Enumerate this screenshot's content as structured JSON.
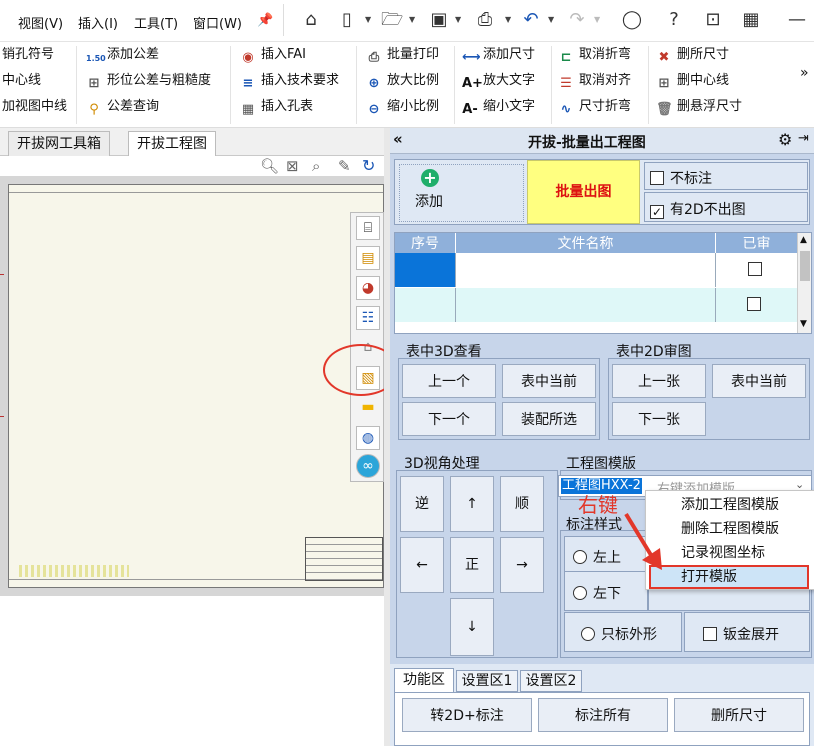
{
  "menubar": {
    "items": [
      "视图(V)",
      "插入(I)",
      "工具(T)",
      "窗口(W)"
    ],
    "pin": "📌",
    "quick_icons": [
      "home-icon",
      "new-file-icon",
      "open-folder-icon",
      "save-icon",
      "print-icon",
      "undo-icon",
      "redo-icon",
      "user-icon",
      "help-icon",
      "minimize-icon"
    ]
  },
  "ribbon": {
    "col1": [
      "销孔符号",
      "中心线",
      "加视图中线"
    ],
    "col2": [
      "添加公差",
      "形位公差与粗糙度",
      "公差查询"
    ],
    "col3": [
      "插入FAI",
      "插入技术要求",
      "插入孔表"
    ],
    "col4": [
      "批量打印",
      "放大比例",
      "缩小比例"
    ],
    "col5": [
      "添加尺寸",
      "放大文字",
      "缩小文字"
    ],
    "col6": [
      "取消折弯",
      "取消对齐",
      "尺寸折弯"
    ],
    "col7": [
      "删所尺寸",
      "删中心线",
      "删悬浮尺寸"
    ],
    "icon_labels": {
      "tol": "1.50",
      "bigA": "A+",
      "smallA": "A-"
    },
    "more": "»"
  },
  "left_tabs": [
    "开拔网工具箱",
    "开拔工程图"
  ],
  "panel": {
    "title": "开拔-批量出工程图",
    "collapse": "«",
    "add_label": "添加",
    "batch_label": "批量出图",
    "no_annotate": "不标注",
    "skip_2d": "有2D不出图",
    "skip_2d_checked": true,
    "table_headers": [
      "序号",
      "文件名称",
      "已审"
    ],
    "group_3d": "表中3D查看",
    "btn_prev": "上一个",
    "btn_current3d": "表中当前",
    "btn_next": "下一个",
    "btn_assembly": "装配所选",
    "group_2d": "表中2D审图",
    "btn_prev_sheet": "上一张",
    "btn_current2d": "表中当前",
    "btn_next_sheet": "下一张",
    "group_view": "3D视角处理",
    "view_btns": [
      "逆",
      "↑",
      "顺",
      "←",
      "正",
      "→",
      "↓"
    ],
    "group_template": "工程图模版",
    "template_value": "工程图HXX-2",
    "template_hint": "右键添加模版",
    "group_style": "标注样式",
    "style_opts": [
      "左上",
      "左下"
    ],
    "only_outline": "只标外形",
    "sheetmetal": "钣金展开",
    "bottom_tabs": [
      "功能区",
      "设置区1",
      "设置区2"
    ],
    "bottom_btns": [
      "转2D+标注",
      "标注所有",
      "删所尺寸"
    ]
  },
  "context_menu": {
    "items": [
      "添加工程图模版",
      "删除工程图模版",
      "记录视图坐标",
      "打开模版"
    ]
  },
  "annotation": {
    "right_click": "右键",
    "color": "#e2372a"
  }
}
